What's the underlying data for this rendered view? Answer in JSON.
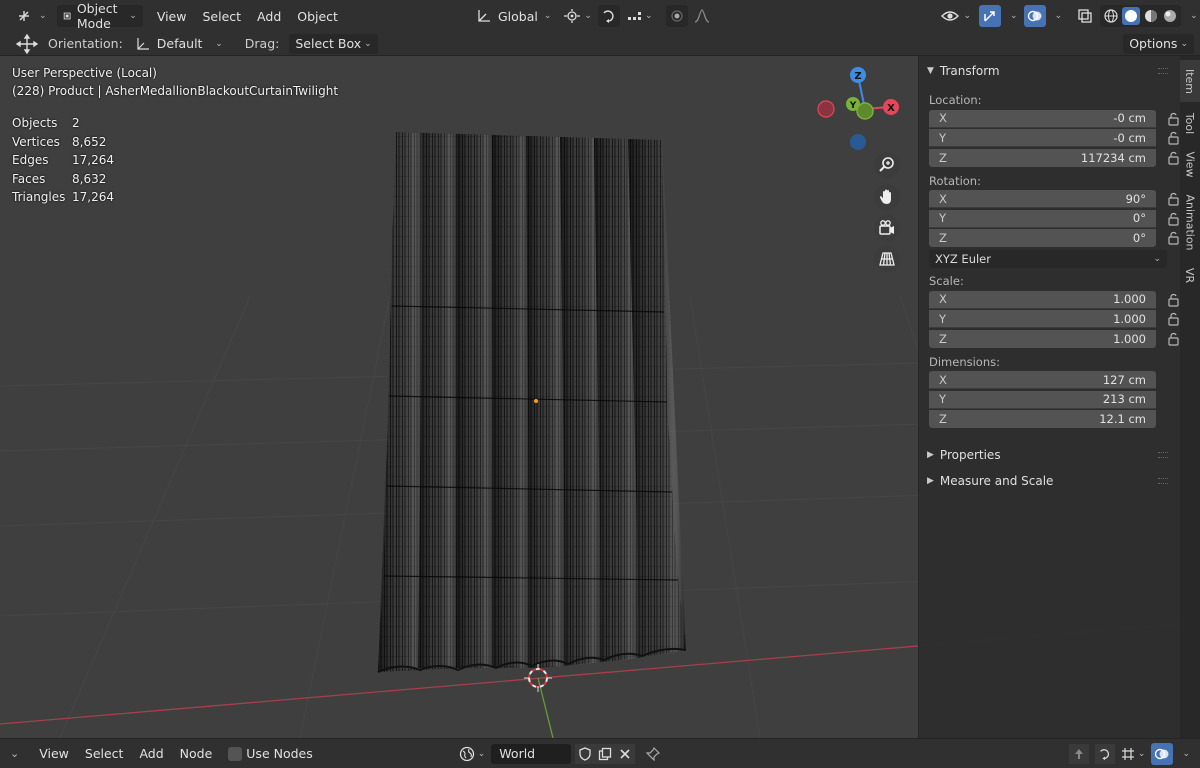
{
  "header": {
    "mode_label": "Object Mode",
    "menus": [
      "View",
      "Select",
      "Add",
      "Object"
    ],
    "transform_orientation": "Global",
    "icons": [
      "editor-type-icon",
      "object-mode-icon",
      "pivot-icon",
      "snap-icon",
      "proportional-editing-icon",
      "visibility-icon",
      "gizmo-icon",
      "overlay-icon",
      "xray-icon",
      "shading-wireframe-icon",
      "shading-solid-icon",
      "shading-material-icon",
      "shading-rendered-icon"
    ]
  },
  "toolbar": {
    "orientation_label": "Orientation:",
    "orientation_value": "Default",
    "drag_label": "Drag:",
    "drag_value": "Select Box",
    "options_label": "Options"
  },
  "viewport": {
    "perspective": "User Perspective (Local)",
    "object_info": "(228) Product | AsherMedallionBlackoutCurtainTwilight",
    "stats": [
      {
        "key": "Objects",
        "value": "2"
      },
      {
        "key": "Vertices",
        "value": "8,652"
      },
      {
        "key": "Edges",
        "value": "17,264"
      },
      {
        "key": "Faces",
        "value": "8,632"
      },
      {
        "key": "Triangles",
        "value": "17,264"
      }
    ],
    "gizmo": {
      "x": "X",
      "y": "Y",
      "z": "Z"
    },
    "nav_icons": [
      "zoom-icon",
      "hand-pan-icon",
      "camera-icon",
      "perspective-grid-icon"
    ]
  },
  "npanel": {
    "transform_title": "Transform",
    "location_label": "Location:",
    "location": [
      {
        "axis": "X",
        "value": "-0 cm"
      },
      {
        "axis": "Y",
        "value": "-0 cm"
      },
      {
        "axis": "Z",
        "value": "117234 cm"
      }
    ],
    "rotation_label": "Rotation:",
    "rotation": [
      {
        "axis": "X",
        "value": "90°"
      },
      {
        "axis": "Y",
        "value": "0°"
      },
      {
        "axis": "Z",
        "value": "0°"
      }
    ],
    "rotation_mode": "XYZ Euler",
    "scale_label": "Scale:",
    "scale": [
      {
        "axis": "X",
        "value": "1.000"
      },
      {
        "axis": "Y",
        "value": "1.000"
      },
      {
        "axis": "Z",
        "value": "1.000"
      }
    ],
    "dimensions_label": "Dimensions:",
    "dimensions": [
      {
        "axis": "X",
        "value": "127 cm"
      },
      {
        "axis": "Y",
        "value": "213 cm"
      },
      {
        "axis": "Z",
        "value": "12.1 cm"
      }
    ],
    "properties_title": "Properties",
    "measure_title": "Measure and Scale",
    "tabs": [
      "Item",
      "Tool",
      "View",
      "Animation",
      "VR"
    ]
  },
  "bottom": {
    "menus": [
      "View",
      "Select",
      "Add",
      "Node"
    ],
    "use_nodes_label": "Use Nodes",
    "world_label": "World"
  },
  "colors": {
    "accent": "#4772b3",
    "x_axis": "#e8455b",
    "y_axis": "#7ab23a",
    "z_axis": "#3d8ce6",
    "viewport_bg": "#3f3f3f",
    "panel_bg": "#2e2e2e"
  }
}
